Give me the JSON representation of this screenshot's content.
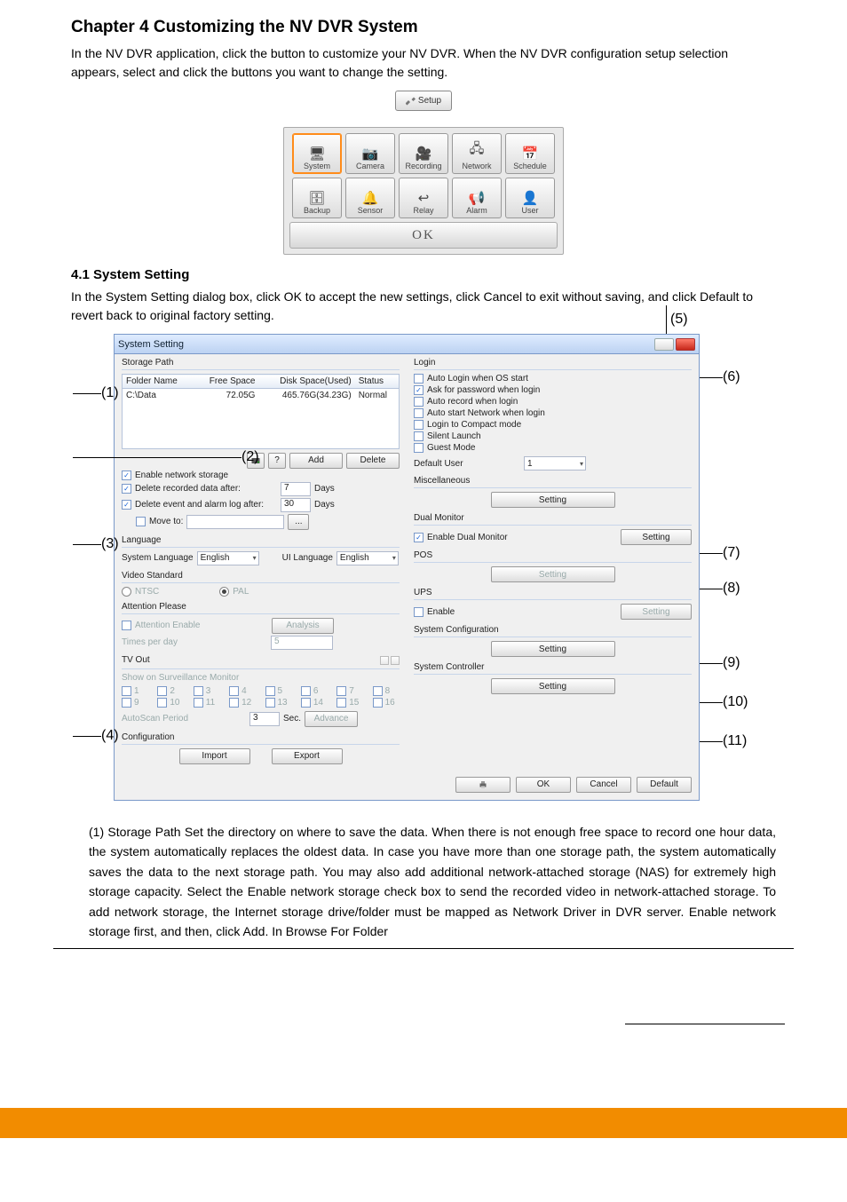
{
  "doc": {
    "chapter_title": "Chapter 4   Customizing the NV DVR System",
    "intro_para": "In the NV DVR application, click the            button to customize your NV DVR. When the NV DVR configuration setup selection appears, select and click the buttons you want to change the setting.",
    "setup_chip_label": "Setup",
    "section_title": "4.1          System Setting",
    "section_para": "In the System Setting dialog box, click OK to accept the new settings, click Cancel to exit without saving, and click Default to revert back to original factory setting.",
    "footer_left": "",
    "footer_right": "",
    "page_number": ""
  },
  "tabbar": {
    "items": [
      "System",
      "Camera",
      "Recording",
      "Network",
      "Schedule",
      "Backup",
      "Sensor",
      "Relay",
      "Alarm",
      "User"
    ],
    "active_index": 0,
    "ok_label": "OK"
  },
  "callouts": {
    "left": [
      "(1)",
      "(2)",
      "(3)",
      "(4)"
    ],
    "right": [
      "(5)",
      "(6)",
      "(7)",
      "(8)",
      "(9)",
      "(10)",
      "(11)"
    ]
  },
  "dialog": {
    "title": "System Setting",
    "storage": {
      "title": "Storage Path",
      "cols": [
        "Folder Name",
        "Free Space",
        "Disk Space(Used)",
        "Status"
      ],
      "row": {
        "folder": "C:\\Data",
        "free": "72.05G",
        "disk": "465.76G(34.23G)",
        "status": "Normal"
      },
      "drive_icon": "disk-icon",
      "help_icon": "?",
      "add": "Add",
      "delete": "Delete",
      "enable_net": "Enable network storage",
      "enable_net_checked": true,
      "del_rec": "Delete recorded data after:",
      "del_rec_checked": true,
      "del_rec_days": "7",
      "days": "Days",
      "del_evt": "Delete event and alarm log after:",
      "del_evt_checked": true,
      "del_evt_days": "30",
      "move_to": "Move to:",
      "move_to_checked": false,
      "browse": "..."
    },
    "language": {
      "title": "Language",
      "sys_lang_label": "System Language",
      "sys_lang_value": "English",
      "ui_lang_label": "UI Language",
      "ui_lang_value": "English"
    },
    "video_std": {
      "title": "Video Standard",
      "ntsc": "NTSC",
      "pal": "PAL",
      "selected": "PAL"
    },
    "attention": {
      "title": "Attention Please",
      "enable": "Attention Enable",
      "analysis": "Analysis",
      "times": "Times per day",
      "times_value": "5"
    },
    "tvout": {
      "title": "TV Out",
      "show_label": "Show on Surveillance Monitor",
      "nums": [
        "1",
        "2",
        "3",
        "4",
        "5",
        "6",
        "7",
        "8",
        "9",
        "10",
        "11",
        "12",
        "13",
        "14",
        "15",
        "16"
      ],
      "autoscan": "AutoScan Period",
      "autoscan_value": "3",
      "sec": "Sec.",
      "advance": "Advance"
    },
    "config": {
      "title": "Configuration",
      "import": "Import",
      "export": "Export"
    },
    "login": {
      "title": "Login",
      "items": [
        {
          "label": "Auto Login when OS start",
          "checked": false
        },
        {
          "label": "Ask for password when login",
          "checked": true
        },
        {
          "label": "Auto record when login",
          "checked": false
        },
        {
          "label": "Auto start Network when login",
          "checked": false
        },
        {
          "label": "Login to Compact mode",
          "checked": false
        },
        {
          "label": "Silent Launch",
          "checked": false
        },
        {
          "label": "Guest Mode",
          "checked": false
        }
      ],
      "default_user_label": "Default User",
      "default_user_value": "1"
    },
    "misc": {
      "title": "Miscellaneous",
      "setting": "Setting"
    },
    "dual": {
      "title": "Dual Monitor",
      "enable": "Enable Dual Monitor",
      "enable_checked": true,
      "setting": "Setting"
    },
    "pos": {
      "title": "POS",
      "setting": "Setting"
    },
    "ups": {
      "title": "UPS",
      "enable": "Enable",
      "enable_checked": false,
      "setting": "Setting"
    },
    "syscfg": {
      "title": "System Configuration",
      "setting": "Setting"
    },
    "sysctl": {
      "title": "System Controller",
      "setting": "Setting"
    },
    "footer": {
      "ok": "OK",
      "cancel": "Cancel",
      "default": "Default"
    }
  },
  "bottom_text": "(1)  Storage Path\nSet the directory on where to save the data. When there is not enough free space to record one hour data, the system automatically replaces the oldest data. In case you have more than one storage path, the system automatically saves the data to the next storage path. You may also add additional network-attached storage (NAS) for extremely high storage capacity. Select the Enable network storage check box to send the recorded video in network-attached storage. To add network storage, the Internet storage drive/folder must be mapped as Network Driver in DVR server. Enable network storage first, and then, click Add. In Browse For Folder"
}
